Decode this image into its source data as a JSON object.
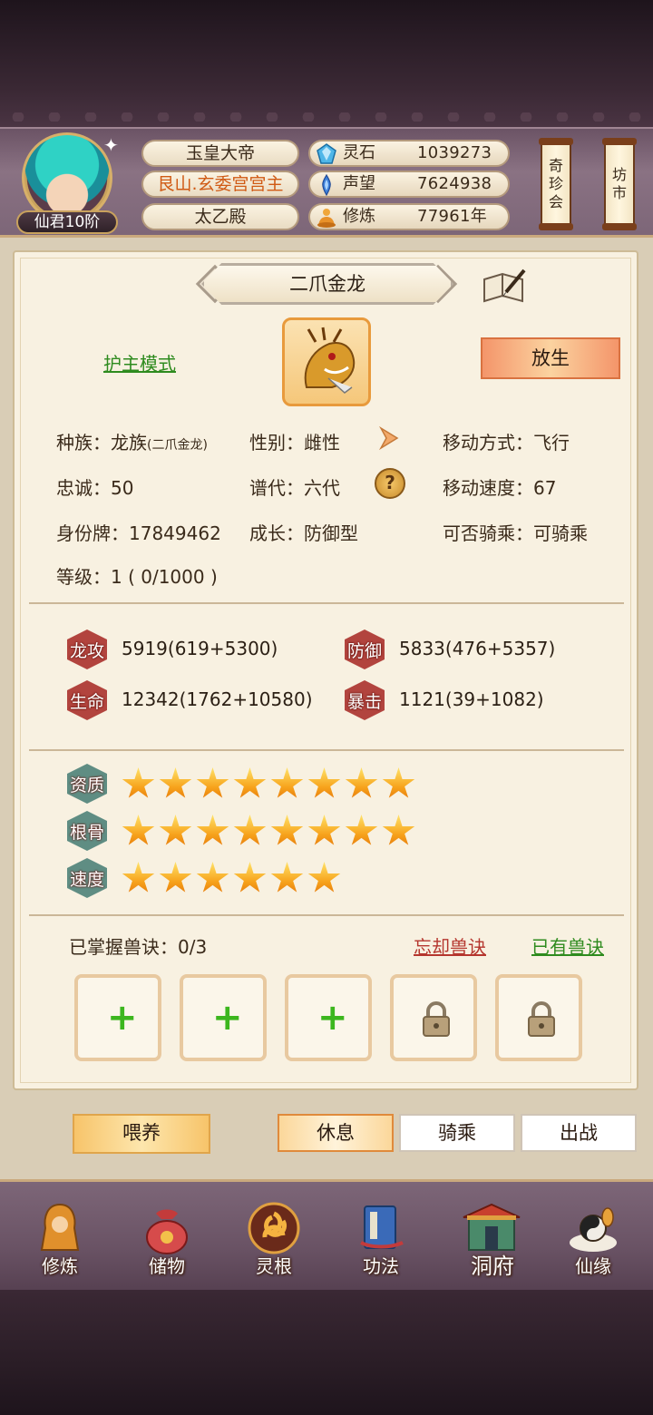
{
  "header": {
    "rank_badge": "仙君10阶",
    "titles": [
      "玉皇大帝",
      "艮山.玄委宫宫主",
      "太乙殿"
    ],
    "resources": [
      {
        "icon": "spirit-stone-icon",
        "label": "灵石",
        "value": "1039273"
      },
      {
        "icon": "reputation-icon",
        "label": "声望",
        "value": "7624938"
      },
      {
        "icon": "cultivation-icon",
        "label": "修炼",
        "value": "77961年"
      }
    ],
    "side_buttons": {
      "treasure": [
        "奇",
        "珍",
        "会"
      ],
      "market": [
        "坊",
        "市"
      ]
    }
  },
  "pet": {
    "name": "二爪金龙",
    "guard_mode_link": "护主模式",
    "release_button": "放生",
    "info": {
      "race_label": "种族：龙族",
      "race_sub": "(二爪金龙)",
      "gender": "性别：雌性",
      "move_type": "移动方式：飞行",
      "loyalty": "忠诚：50",
      "generation": "谱代：六代",
      "move_speed": "移动速度：67",
      "id_tag": "身份牌：17849462",
      "growth": "成长：防御型",
      "rideable": "可否骑乘：可骑乘",
      "level": "等级：1 ( 0/1000 )"
    },
    "stats": [
      {
        "badge": "龙攻",
        "value": "5919(619+5300)"
      },
      {
        "badge": "防御",
        "value": "5833(476+5357)"
      },
      {
        "badge": "生命",
        "value": "12342(1762+10580)"
      },
      {
        "badge": "暴击",
        "value": "1121(39+1082)"
      }
    ],
    "ratings": [
      {
        "badge": "资质",
        "stars": 8
      },
      {
        "badge": "根骨",
        "stars": 8
      },
      {
        "badge": "速度",
        "stars": 6
      }
    ],
    "skills": {
      "mastered_label": "已掌握兽诀：0/3",
      "forget_link": "忘却兽诀",
      "owned_link": "已有兽诀"
    }
  },
  "actions": {
    "feed": "喂养",
    "rest": "休息",
    "ride": "骑乘",
    "battle": "出战"
  },
  "nav": [
    {
      "label": "修炼",
      "icon": "cultivate-icon"
    },
    {
      "label": "储物",
      "icon": "storage-bag-icon"
    },
    {
      "label": "灵根",
      "icon": "spirit-root-icon"
    },
    {
      "label": "功法",
      "icon": "technique-book-icon"
    },
    {
      "label": "洞府",
      "icon": "cave-mansion-icon"
    },
    {
      "label": "仙缘",
      "icon": "immortal-fate-icon"
    }
  ],
  "colors": {
    "accent_orange": "#f4956a",
    "link_green": "#2e8b1e",
    "link_red": "#b5362e",
    "gold": "#caa97d"
  }
}
